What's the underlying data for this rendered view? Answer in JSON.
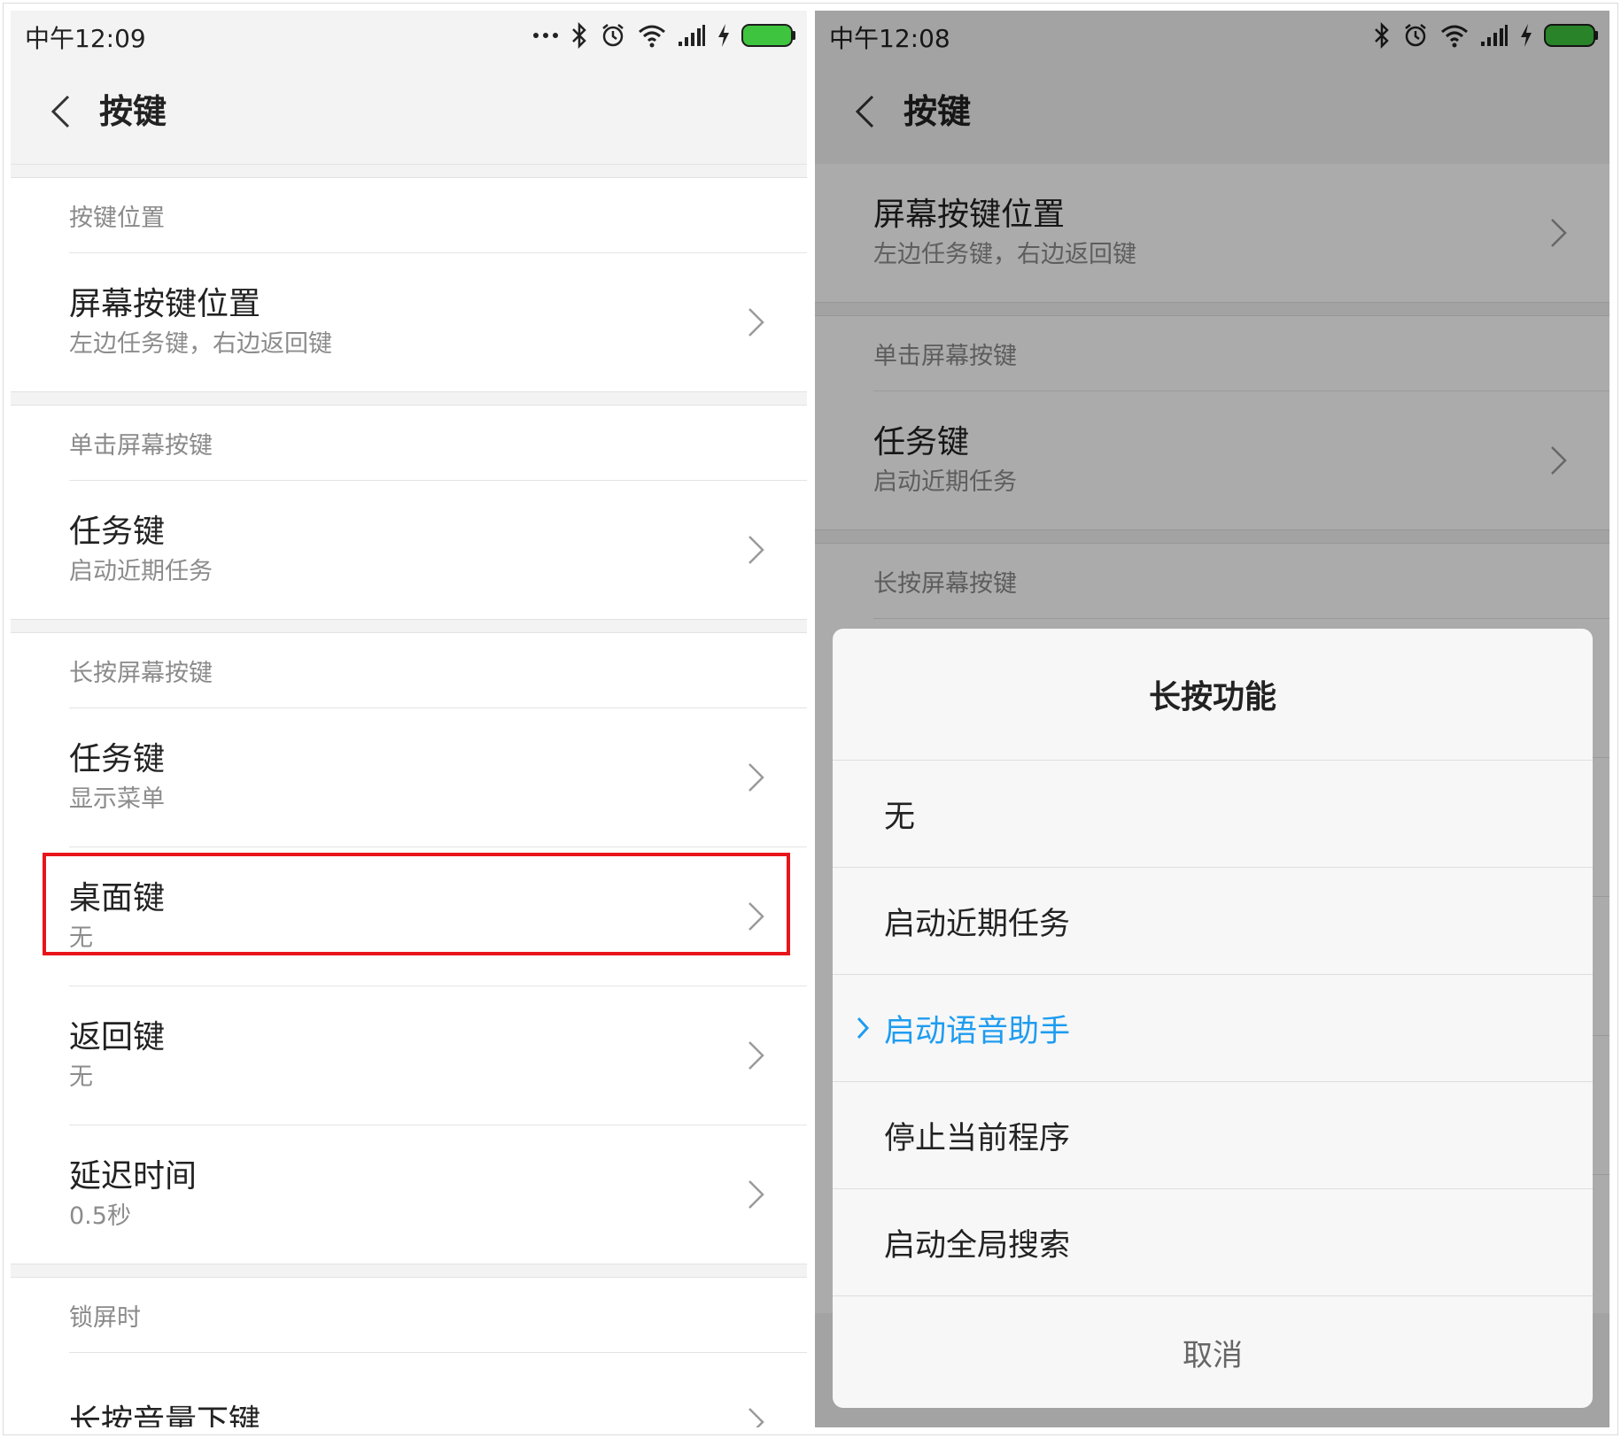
{
  "left": {
    "status": {
      "time": "中午12:09"
    },
    "title": "按键",
    "sections": {
      "position_header": "按键位置",
      "screen_key_position": {
        "title": "屏幕按键位置",
        "value": "左边任务键，右边返回键"
      },
      "single_header": "单击屏幕按键",
      "single_task": {
        "title": "任务键",
        "value": "启动近期任务"
      },
      "long_header": "长按屏幕按键",
      "long_task": {
        "title": "任务键",
        "value": "显示菜单"
      },
      "long_home": {
        "title": "桌面键",
        "value": "无"
      },
      "long_back": {
        "title": "返回键",
        "value": "无"
      },
      "delay": {
        "title": "延迟时间",
        "value": "0.5秒"
      },
      "lock_header": "锁屏时",
      "vol_down": {
        "title": "长按音量下键"
      }
    }
  },
  "right": {
    "status": {
      "time": "中午12:08"
    },
    "title": "按键",
    "sections": {
      "screen_key_position": {
        "title": "屏幕按键位置",
        "value": "左边任务键，右边返回键"
      },
      "single_header": "单击屏幕按键",
      "single_task": {
        "title": "任务键",
        "value": "启动近期任务"
      },
      "long_header": "长按屏幕按键"
    },
    "dialog": {
      "title": "长按功能",
      "options": [
        {
          "label": "无",
          "selected": false
        },
        {
          "label": "启动近期任务",
          "selected": false
        },
        {
          "label": "启动语音助手",
          "selected": true
        },
        {
          "label": "停止当前程序",
          "selected": false
        },
        {
          "label": "启动全局搜索",
          "selected": false
        }
      ],
      "cancel": "取消"
    }
  },
  "colors": {
    "accent": "#1e9cf0",
    "highlight": "#e8141c",
    "battery": "#3ec43e"
  },
  "icons": [
    "more-dots-icon",
    "bluetooth-icon",
    "alarm-icon",
    "wifi-icon",
    "signal-icon",
    "charging-icon",
    "battery-icon",
    "back-arrow-icon",
    "chevron-right-icon",
    "check-chevron-icon"
  ]
}
